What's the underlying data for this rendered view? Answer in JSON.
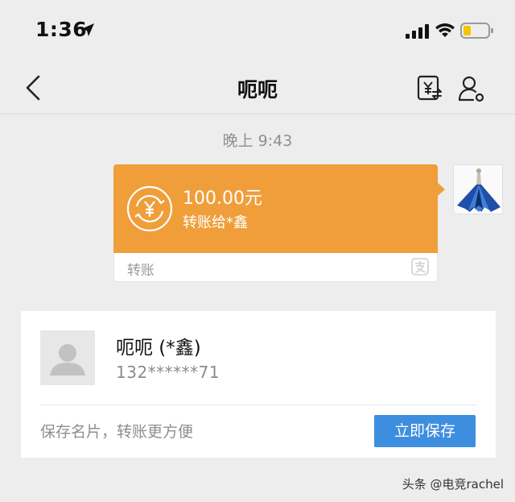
{
  "status_bar": {
    "time": "1:36"
  },
  "nav": {
    "title": "呃呃"
  },
  "chat": {
    "timestamp": "晚上 9:43",
    "transfer": {
      "amount": "100.00元",
      "description": "转账给*鑫",
      "type_label": "转账",
      "accent_color": "#f09e3a"
    }
  },
  "contact": {
    "name": "呃呃 (*鑫)",
    "phone": "132******71",
    "hint": "保存名片，转账更方便",
    "save_label": "立即保存",
    "button_color": "#3e8ee0"
  },
  "watermark": "头条 @电竞rachel",
  "icons": {
    "status": [
      "location-arrow-icon",
      "cellular-signal-icon",
      "wifi-icon",
      "battery-icon"
    ],
    "nav": [
      "back-chevron-icon",
      "transfer-yuan-icon",
      "profile-settings-icon"
    ],
    "card": [
      "yuan-circle-icon",
      "alipay-icon"
    ]
  }
}
